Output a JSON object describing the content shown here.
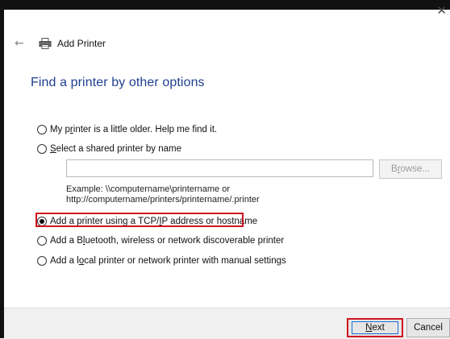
{
  "window": {
    "close_glyph": "✕",
    "back_glyph": "←",
    "title": "Add Printer"
  },
  "page": {
    "heading": "Find a printer by other options"
  },
  "options": [
    {
      "pre": "My p",
      "key": "r",
      "post": "inter is a little older. Help me find it.",
      "checked": false
    },
    {
      "pre": "",
      "key": "S",
      "post": "elect a shared printer by name",
      "checked": false
    },
    {
      "pre": "Add a printer using a TCP/",
      "key": "I",
      "post": "P address or hostname",
      "checked": true
    },
    {
      "pre": "Add a B",
      "key": "l",
      "post": "uetooth, wireless or network discoverable printer",
      "checked": false
    },
    {
      "pre": "Add a l",
      "key": "o",
      "post": "cal printer or network printer with manual settings",
      "checked": false
    }
  ],
  "shared_printer": {
    "value": "",
    "browse_pre": "B",
    "browse_key": "r",
    "browse_post": "owse...",
    "example_line1": "Example: \\\\computername\\printername or",
    "example_line2": "http://computername/printers/printername/.printer"
  },
  "footer": {
    "next_key": "N",
    "next_post": "ext",
    "cancel_label": "Cancel"
  },
  "colors": {
    "heading": "#1f3f8f",
    "highlight": "#d0141e",
    "footer_bg": "#f0f0f0"
  }
}
